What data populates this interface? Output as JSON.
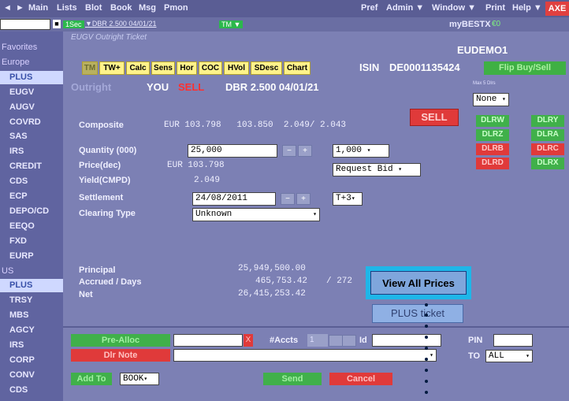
{
  "topbar": {
    "items": [
      "Main",
      "Lists",
      "Blot",
      "Book",
      "Msg",
      "Pmon"
    ],
    "right_items": [
      "Pref",
      "Admin ▼",
      "Window ▼",
      "Print",
      "Help ▼"
    ],
    "axe": "AXE"
  },
  "bar2": {
    "tag1": "1Sec",
    "instrument": "▼DBR 2.500 04/01/21",
    "tag2": "TM ▼",
    "user_label": "myBESTX",
    "user_value": "€0"
  },
  "sidebar": {
    "items": [
      {
        "label": "Favorites",
        "head": true
      },
      {
        "label": "Europe",
        "head": true
      },
      {
        "label": "PLUS",
        "selected": true
      },
      {
        "label": "EUGV"
      },
      {
        "label": "AUGV"
      },
      {
        "label": "COVRD"
      },
      {
        "label": "SAS"
      },
      {
        "label": "IRS"
      },
      {
        "label": "CREDIT"
      },
      {
        "label": "CDS"
      },
      {
        "label": "ECP"
      },
      {
        "label": "DEPO/CD"
      },
      {
        "label": "EEQO"
      },
      {
        "label": "FXD"
      },
      {
        "label": "EURP"
      },
      {
        "label": "US",
        "head": true
      },
      {
        "label": "PLUS",
        "selected": true
      },
      {
        "label": "TRSY"
      },
      {
        "label": "MBS"
      },
      {
        "label": "AGCY"
      },
      {
        "label": "IRS"
      },
      {
        "label": "CORP"
      },
      {
        "label": "CONV"
      },
      {
        "label": "CDS"
      }
    ]
  },
  "ticket": {
    "window_title": "EUGV Outright Ticket",
    "account": "EUDEMO1",
    "tabs": [
      "TM",
      "TW+",
      "Calc",
      "Sens",
      "Hor",
      "COC",
      "HVol",
      "SDesc",
      "Chart"
    ],
    "isin_label": "ISIN",
    "isin": "DE0001135424",
    "flip": "Flip Buy/Sell",
    "outright": "Outright",
    "you": "YOU",
    "side": "SELL",
    "bond": "DBR 2.500 04/01/21",
    "sell_button": "SELL",
    "max_label": "Max 5 Dlrs",
    "none_select": "None",
    "composite_label": "Composite",
    "composite_value": "EUR 103.798   103.850  2.049/ 2.043",
    "quantity_label": "Quantity (000)",
    "quantity": "25,000",
    "quantity_step": "1,000",
    "price_label": "Price(dec)",
    "price_value": "EUR 103.798",
    "request": "Request Bid",
    "yield_label": "Yield(CMPD)",
    "yield_value": "2.049",
    "settlement_label": "Settlement",
    "settlement": "24/08/2011",
    "settle_code": "T+3",
    "clearing_label": "Clearing Type",
    "clearing": "Unknown",
    "principal_label": "Principal",
    "principal": "25,949,500.00",
    "accrued_label": "Accrued / Days",
    "accrued": "465,753.42",
    "days": "/ 272",
    "net_label": "Net",
    "net": "26,415,253.42",
    "view_all": "View All Prices",
    "plus_ticket": "PLUS ticket",
    "dealers": [
      {
        "label": "DLRW",
        "color": "g"
      },
      {
        "label": "DLRY",
        "color": "g"
      },
      {
        "label": "DLRZ",
        "color": "g"
      },
      {
        "label": "DLRA",
        "color": "g"
      },
      {
        "label": "DLRB",
        "color": "r"
      },
      {
        "label": "DLRC",
        "color": "r"
      },
      {
        "label": "DLRD",
        "color": "r"
      },
      {
        "label": "DLRX",
        "color": "g"
      }
    ],
    "pre_alloc": "Pre-Alloc",
    "dlr_note": "Dlr Note",
    "x": "X",
    "accts_label": "#Accts",
    "accts_value": "1",
    "id_label": "Id",
    "pin_label": "PIN",
    "to_label": "TO",
    "to_value": "ALL",
    "add_to": "Add To",
    "book": "BOOK",
    "send": "Send",
    "cancel": "Cancel"
  }
}
